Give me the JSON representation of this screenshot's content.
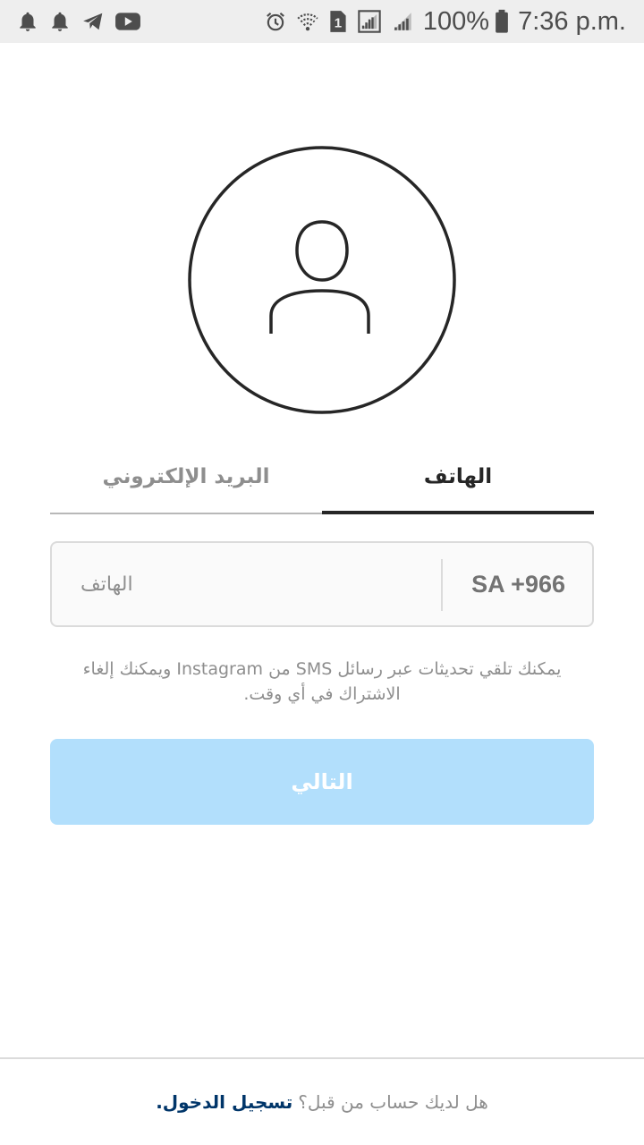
{
  "status_bar": {
    "battery_percent": "100%",
    "time": "7:36 p.m.",
    "sim_badge": "1",
    "left_icons": [
      "bell-icon",
      "bell-icon",
      "telegram-icon",
      "youtube-icon"
    ],
    "right_icons": [
      "alarm-icon",
      "wifi-icon",
      "sim-icon",
      "signal-box-icon",
      "signal-icon",
      "battery-icon"
    ]
  },
  "avatar": {
    "icon": "user-profile-icon"
  },
  "tabs": {
    "phone_label": "الهاتف",
    "email_label": "البريد الإلكتروني",
    "active": "phone"
  },
  "phone_form": {
    "country_code": "SA +966",
    "placeholder": "الهاتف",
    "value": ""
  },
  "info": {
    "line1": "يمكنك تلقي تحديثات عبر رسائل SMS من Instagram ويمكنك إلغاء",
    "line2": "الاشتراك في أي وقت."
  },
  "next_button": {
    "label": "التالي"
  },
  "footer": {
    "question": "هل لديك حساب من قبل؟",
    "login_link": "تسجيل الدخول."
  },
  "colors": {
    "primary_text": "#262626",
    "muted_text": "#8e8e8e",
    "button_disabled": "#b2dffc",
    "link": "#003569",
    "status_bar_bg": "#eeeeee"
  }
}
